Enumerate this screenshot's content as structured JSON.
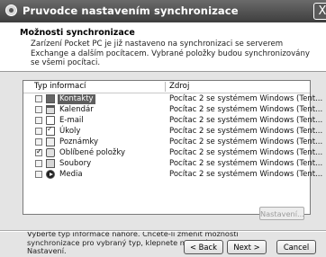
{
  "window": {
    "title": "Pruvodce nastavením synchronizace",
    "close_label": "X"
  },
  "header": {
    "title": "Možnosti synchronizace",
    "description": "Zarízení Pocket PC je již nastaveno na synchronizaci se serverem Exchange a dalším pocítacem. Vybrané položky budou synchronizovány se všemi pocítaci."
  },
  "list": {
    "columns": [
      "Typ informací",
      "Zdroj"
    ],
    "items": [
      {
        "name": "Kontakty",
        "icon": "contacts-icon",
        "checked": false,
        "selected": true,
        "source": "Pocítac 2 se systémem Windows (Tent..."
      },
      {
        "name": "Kalendár",
        "icon": "calendar-icon",
        "checked": false,
        "selected": false,
        "source": "Pocítac 2 se systémem Windows (Tent..."
      },
      {
        "name": "E-mail",
        "icon": "email-icon",
        "checked": false,
        "selected": false,
        "source": "Pocítac 2 se systémem Windows (Tent..."
      },
      {
        "name": "Úkoly",
        "icon": "tasks-icon",
        "checked": false,
        "selected": false,
        "source": "Pocítac 2 se systémem Windows (Tent..."
      },
      {
        "name": "Poznámky",
        "icon": "notes-icon",
        "checked": false,
        "selected": false,
        "source": "Pocítac 2 se systémem Windows (Tent..."
      },
      {
        "name": "Oblíbené položky",
        "icon": "favorites-icon",
        "checked": true,
        "selected": false,
        "source": "Pocítac 2 se systémem Windows (Tent..."
      },
      {
        "name": "Soubory",
        "icon": "files-icon",
        "checked": false,
        "selected": false,
        "source": "Pocítac 2 se systémem Windows (Tent..."
      },
      {
        "name": "Media",
        "icon": "media-icon",
        "checked": false,
        "selected": false,
        "source": "Pocítac 2 se systémem Windows (Tent..."
      }
    ]
  },
  "hint": "Vyberte typ informace nahore. Chcete-li zmenit možnosti synchronizace pro vybraný typ, klepnete na tlacítko Nastavení.",
  "buttons": {
    "settings": "Nastavení...",
    "back": "< Back",
    "next": "Next >",
    "cancel": "Cancel"
  }
}
